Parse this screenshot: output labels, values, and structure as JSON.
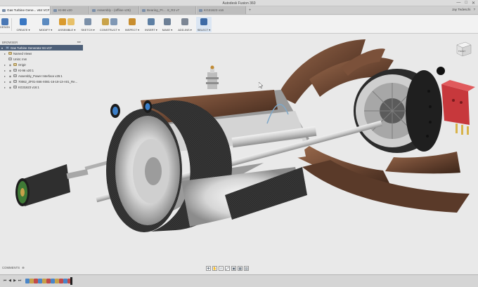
{
  "window": {
    "app_title": "Autodesk Fusion 360",
    "controls": [
      "—",
      "□",
      "✕"
    ]
  },
  "quick_access": [
    "grid-icon",
    "file-icon",
    "save-icon",
    "undo-icon",
    "redo-icon"
  ],
  "tabs": [
    {
      "label": "Gas Turbine Gene... v84 VCF",
      "active": true
    },
    {
      "label": "Kt-96 v20",
      "active": false
    },
    {
      "label": "Assembly - (offline v25)",
      "active": false
    },
    {
      "label": "Bearing_Pr.... 8_R3 v7",
      "active": false
    },
    {
      "label": "KG31623 v16",
      "active": false
    }
  ],
  "user": {
    "name": "Jay Tedeschi",
    "help": "?"
  },
  "ribbon": {
    "workspace": "DESIGN",
    "groups": [
      {
        "label": "CREATE ▾",
        "icons": [
          "#3a77c2",
          "#6aa0d8"
        ]
      },
      {
        "label": "MODIFY ▾",
        "icons": [
          "#5b8ac0",
          "#9bbbe0"
        ]
      },
      {
        "label": "ASSEMBLE ▾",
        "icons": [
          "#d99a2e",
          "#e7c069"
        ]
      },
      {
        "label": "SKETCH ▾",
        "icons": [
          "#7a8fa8"
        ]
      },
      {
        "label": "CONSTRUCT ▾",
        "icons": [
          "#c9a34a",
          "#7f97b4"
        ]
      },
      {
        "label": "INSPECT ▾",
        "icons": [
          "#c88d2e"
        ]
      },
      {
        "label": "INSERT ▾",
        "icons": [
          "#5d7fa3"
        ]
      },
      {
        "label": "MAKE ▾",
        "icons": [
          "#6c7f95"
        ]
      },
      {
        "label": "ADD-INS ▾",
        "icons": [
          "#7c8694"
        ]
      },
      {
        "label": "SELECT ▾",
        "icons": [
          "#3d6aa5"
        ]
      }
    ]
  },
  "browser": {
    "title": "BROWSER",
    "items": [
      {
        "label": "Gas Turbine Generator 84 vCF",
        "type": "root",
        "indent": 0
      },
      {
        "label": "Named Views",
        "type": "folder",
        "indent": 1
      },
      {
        "label": "Units: mm",
        "type": "doc",
        "indent": 1
      },
      {
        "label": "Origin",
        "type": "folder",
        "indent": 1
      },
      {
        "label": "Kt-96 v20:1",
        "type": "link",
        "indent": 1
      },
      {
        "label": "Assembly_Power Interface v25:1",
        "type": "link",
        "indent": 1
      },
      {
        "label": "70062_ZF01-S66-X081-16-18-13-A01_Re...",
        "type": "link",
        "indent": 1
      },
      {
        "label": "KG31623 v16:1",
        "type": "link",
        "indent": 1
      }
    ]
  },
  "viewcube": {
    "face": "FRONT"
  },
  "comments": {
    "label": "COMMENTS"
  },
  "navbar": [
    "✥",
    "✋",
    "⌕",
    "⤢",
    "▣",
    "▦",
    "▤"
  ],
  "timeline": {
    "controls": [
      "⏮",
      "◀",
      "▶",
      "⏭"
    ],
    "items": [
      "#4a86c8",
      "#c8a24a",
      "#c24a4a",
      "#4a86c8",
      "#c8a24a",
      "#c24a4a",
      "#4a86c8",
      "#c8a24a",
      "#c24a4a",
      "#4a86c8",
      "#c24a4a"
    ]
  },
  "colors": {
    "accent": "#4d5f78",
    "copper": "#6b4632",
    "steel": "#c9c9c9"
  }
}
